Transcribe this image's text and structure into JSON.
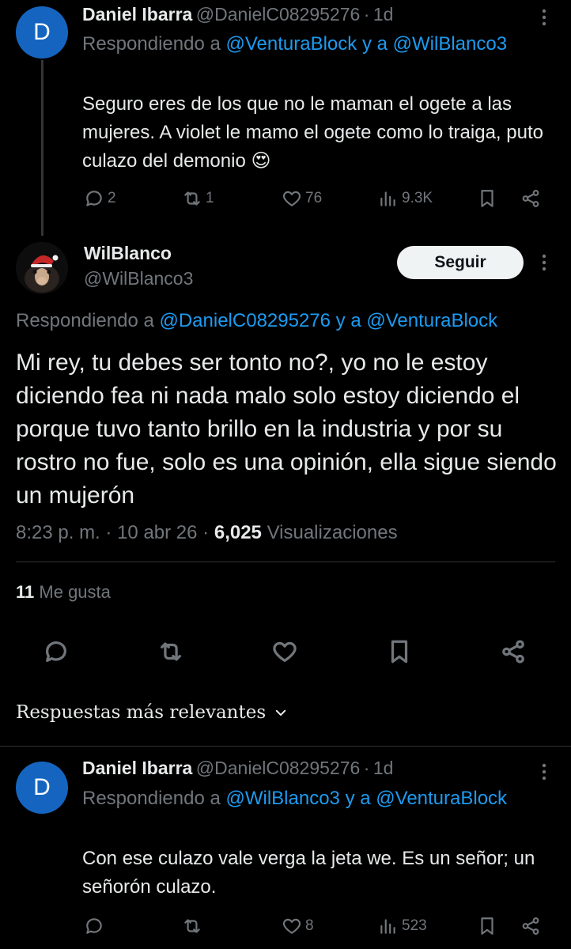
{
  "reply1": {
    "avatar_letter": "D",
    "name": "Daniel Ibarra",
    "handle": "@DanielC08295276",
    "sep": "·",
    "time": "1d",
    "replying_prefix": "Respondiendo a",
    "replying_mention1": "@VenturaBlock",
    "replying_joiner": "y a",
    "replying_mention2": "@WilBlanco3",
    "text": "Seguro eres de los que no le maman el ogete a las mujeres. A violet le mamo el ogete como lo traiga, puto culazo del demonio 😍",
    "replies": "2",
    "reposts": "1",
    "likes": "76",
    "views": "9.3K"
  },
  "main": {
    "name": "WilBlanco",
    "handle": "@WilBlanco3",
    "follow_label": "Seguir",
    "replying_prefix": "Respondiendo a",
    "replying_mention1": "@DanielC08295276",
    "replying_joiner": "y a",
    "replying_mention2": "@VenturaBlock",
    "text": "Mi rey, tu debes ser tonto no?, yo no le estoy diciendo fea ni nada malo solo estoy diciendo el porque tuvo tanto brillo en la industria y por su rostro no fue, solo es una opinión, ella sigue siendo un mujerón",
    "time": "8:23 p. m.",
    "sep": "·",
    "date": "10 abr 26",
    "views_count": "6,025",
    "views_label": "Visualizaciones",
    "likes_count": "11",
    "likes_label": "Me gusta"
  },
  "sort": {
    "label": "Respuestas más relevantes"
  },
  "reply2": {
    "avatar_letter": "D",
    "name": "Daniel Ibarra",
    "handle": "@DanielC08295276",
    "sep": "·",
    "time": "1d",
    "replying_prefix": "Respondiendo a",
    "replying_mention1": "@WilBlanco3",
    "replying_joiner": "y a",
    "replying_mention2": "@VenturaBlock",
    "text": "Con ese culazo vale verga la jeta we. Es un señor; un señorón culazo.",
    "replies": "",
    "reposts": "",
    "likes": "8",
    "views": "523"
  },
  "colors": {
    "background": "#000000",
    "text": "#e7e9ea",
    "secondary": "#71767b",
    "link": "#1d9bf0",
    "avatar": "#1565c0"
  }
}
